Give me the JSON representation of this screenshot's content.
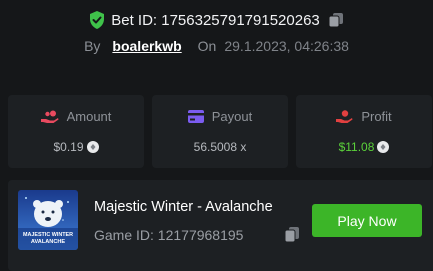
{
  "bet": {
    "label": "Bet ID: 1756325791791520263",
    "by_label": "By",
    "user": "boalerkwb",
    "on_label": "On",
    "date": "29.1.2023, 04:26:38"
  },
  "stats": {
    "amount": {
      "label": "Amount",
      "value": "$0.19",
      "icon": "hand-coins-icon",
      "color": "#e84a5f"
    },
    "payout": {
      "label": "Payout",
      "value": "56.5008 x",
      "icon": "card-icon",
      "color": "#7b5cf0"
    },
    "profit": {
      "label": "Profit",
      "value": "$11.08",
      "icon": "hand-money-icon",
      "color": "#e24040",
      "value_color": "#5bd13a"
    }
  },
  "game": {
    "title": "Majestic Winter - Avalanche",
    "id_label": "Game ID: 12177968195",
    "thumb_text": [
      "MAJESTIC WINTER",
      "AVALANCHE"
    ],
    "play_label": "Play Now"
  },
  "colors": {
    "background": "#151719",
    "card": "#1d2023",
    "accent_green": "#3cb528",
    "shield_green": "#3fc24a"
  }
}
